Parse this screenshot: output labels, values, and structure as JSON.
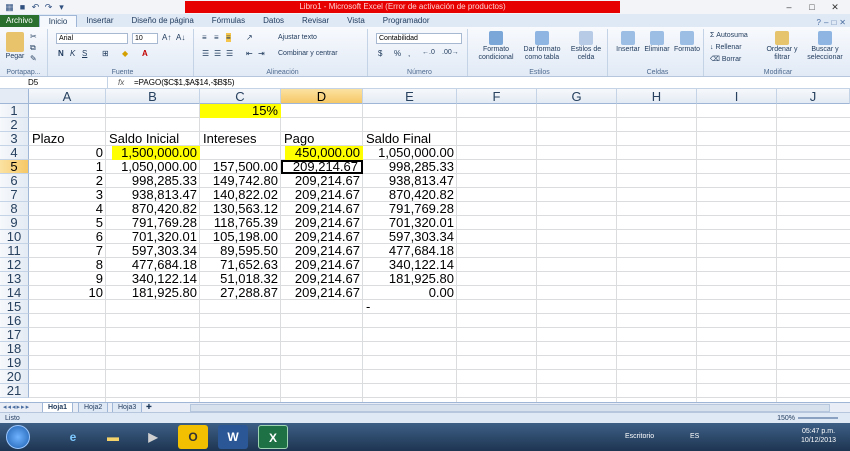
{
  "titlebar": {
    "title": "Libro1 - Microsoft Excel (Error de activación de productos)"
  },
  "tabs": [
    "Archivo",
    "Inicio",
    "Insertar",
    "Diseño de página",
    "Fórmulas",
    "Datos",
    "Revisar",
    "Vista",
    "Programador"
  ],
  "ribbon": {
    "paste": "Pegar",
    "font_name": "Arial",
    "font_size": "10",
    "wrap": "Ajustar texto",
    "merge": "Combinar y centrar",
    "number_format": "Contabilidad",
    "cond_format": "Formato condicional",
    "as_table": "Dar formato como tabla",
    "cell_styles": "Estilos de celda",
    "insert": "Insertar",
    "delete": "Eliminar",
    "format": "Formato",
    "autosum": "Autosuma",
    "fill": "Rellenar",
    "clear": "Borrar",
    "sort": "Ordenar y filtrar",
    "find": "Buscar y seleccionar",
    "groups": {
      "clipboard": "Portapap...",
      "font": "Fuente",
      "alignment": "Alineación",
      "number": "Número",
      "styles": "Estilos",
      "cells": "Celdas",
      "editing": "Modificar"
    }
  },
  "formula_bar": {
    "name_box": "D5",
    "fx": "fx",
    "formula": "=PAGO($C$1,$A$14,-$B$5)"
  },
  "columns": [
    "A",
    "B",
    "C",
    "D",
    "E",
    "F",
    "G",
    "H",
    "I",
    "J"
  ],
  "rows": [
    "1",
    "2",
    "3",
    "4",
    "5",
    "6",
    "7",
    "8",
    "9",
    "10",
    "11",
    "12",
    "13",
    "14",
    "15",
    "16",
    "17",
    "18",
    "19",
    "20",
    "21"
  ],
  "cells": {
    "c1": "15%",
    "headers": {
      "a": "Plazo",
      "b": "Saldo Inicial",
      "c": "Intereses",
      "d": "Pago",
      "e": "Saldo Final"
    },
    "table": [
      {
        "a": "0",
        "b": "1,500,000.00",
        "c": "",
        "d": "450,000.00",
        "e": "1,050,000.00"
      },
      {
        "a": "1",
        "b": "1,050,000.00",
        "c": "157,500.00",
        "d": "209,214.67",
        "e": "998,285.33"
      },
      {
        "a": "2",
        "b": "998,285.33",
        "c": "149,742.80",
        "d": "209,214.67",
        "e": "938,813.47"
      },
      {
        "a": "3",
        "b": "938,813.47",
        "c": "140,822.02",
        "d": "209,214.67",
        "e": "870,420.82"
      },
      {
        "a": "4",
        "b": "870,420.82",
        "c": "130,563.12",
        "d": "209,214.67",
        "e": "791,769.28"
      },
      {
        "a": "5",
        "b": "791,769.28",
        "c": "118,765.39",
        "d": "209,214.67",
        "e": "701,320.01"
      },
      {
        "a": "6",
        "b": "701,320.01",
        "c": "105,198.00",
        "d": "209,214.67",
        "e": "597,303.34"
      },
      {
        "a": "7",
        "b": "597,303.34",
        "c": "89,595.50",
        "d": "209,214.67",
        "e": "477,684.18"
      },
      {
        "a": "8",
        "b": "477,684.18",
        "c": "71,652.63",
        "d": "209,214.67",
        "e": "340,122.14"
      },
      {
        "a": "9",
        "b": "340,122.14",
        "c": "51,018.32",
        "d": "209,214.67",
        "e": "181,925.80"
      },
      {
        "a": "10",
        "b": "181,925.80",
        "c": "27,288.87",
        "d": "209,214.67",
        "e": "0.00"
      }
    ],
    "e14_dash": "-"
  },
  "sheets": [
    "Hoja1",
    "Hoja2",
    "Hoja3"
  ],
  "status": {
    "mode": "Listo",
    "zoom": "150%"
  },
  "taskbar": {
    "desktop": "Escritorio",
    "lang": "ES",
    "time": "05:47 p.m.",
    "date": "10/12/2013"
  },
  "colors": {
    "highlight": "#ffff00",
    "file_tab": "#2a6f2e",
    "title_error": "#e60000"
  }
}
